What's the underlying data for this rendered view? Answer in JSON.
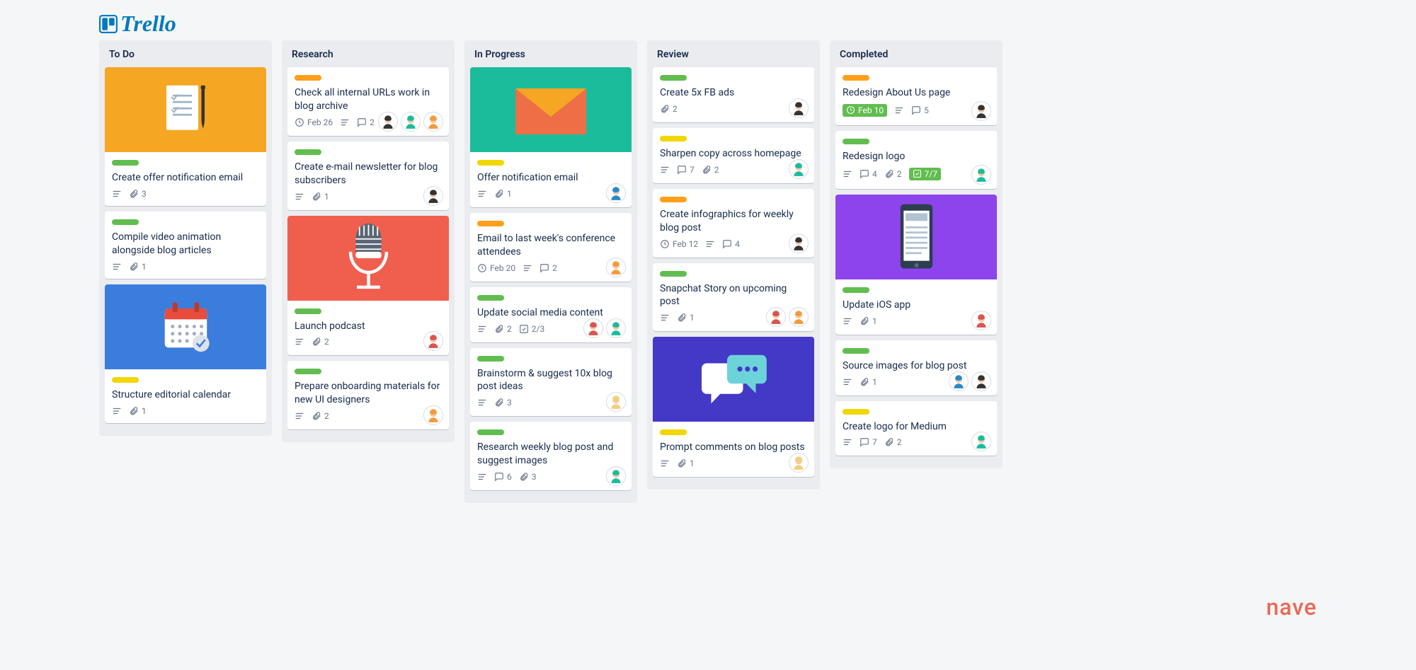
{
  "logo": "Trello",
  "watermark": "nave",
  "avatars": {
    "dark": {
      "hair": "#333",
      "skin": "#f4c9a8"
    },
    "blue": {
      "hair": "#2788c9",
      "skin": "#f4c9a8"
    },
    "orange": {
      "hair": "#f59a3a",
      "skin": "#f4c9a8"
    },
    "teal": {
      "hair": "#1abc9c",
      "skin": "#f4c9a8"
    },
    "redhair": {
      "hair": "#d9534f",
      "skin": "#f4c9a8"
    },
    "blonde": {
      "hair": "#f3cf7a",
      "skin": "#f4c9a8"
    }
  },
  "columns": [
    {
      "title": "To Do",
      "cards": [
        {
          "cover": "orange",
          "coverIcon": "document",
          "labels": [
            "green"
          ],
          "title": "Create offer notification email",
          "description": true,
          "attachments": "3",
          "members": []
        },
        {
          "labels": [
            "green"
          ],
          "title": "Compile video animation alongside blog articles",
          "description": true,
          "attachments": "1",
          "members": []
        },
        {
          "cover": "blue",
          "coverIcon": "calendar",
          "labels": [
            "yellow"
          ],
          "title": "Structure editorial calendar",
          "description": true,
          "attachments": "1",
          "members": []
        }
      ]
    },
    {
      "title": "Research",
      "cards": [
        {
          "labels": [
            "orange"
          ],
          "title": "Check all internal URLs work in blog archive",
          "due": "Feb 26",
          "description": true,
          "comments": "2",
          "members": [
            "dark",
            "teal",
            "orange"
          ]
        },
        {
          "labels": [
            "green"
          ],
          "title": "Create e-mail newsletter for blog subscribers",
          "description": true,
          "attachments": "1",
          "members": [
            "dark"
          ]
        },
        {
          "cover": "red",
          "coverIcon": "mic",
          "labels": [
            "green"
          ],
          "title": "Launch podcast",
          "description": true,
          "attachments": "2",
          "members": [
            "redhair"
          ]
        },
        {
          "labels": [
            "green"
          ],
          "title": "Prepare onboarding materials for new UI designers",
          "description": true,
          "attachments": "2",
          "members": [
            "orange"
          ]
        }
      ]
    },
    {
      "title": "In Progress",
      "cards": [
        {
          "cover": "teal",
          "coverIcon": "envelope",
          "labels": [
            "yellow"
          ],
          "title": "Offer notification email",
          "description": true,
          "attachments": "1",
          "members": [
            "blue"
          ]
        },
        {
          "labels": [
            "orange"
          ],
          "title": "Email to last week's conference attendees",
          "due": "Feb 20",
          "description": true,
          "comments": "2",
          "members": [
            "orange"
          ]
        },
        {
          "labels": [
            "green"
          ],
          "title": "Update social media content",
          "description": true,
          "attachments": "2",
          "checklist": "2/3",
          "members": [
            "redhair",
            "teal"
          ]
        },
        {
          "labels": [
            "green"
          ],
          "title": "Brainstorm & suggest 10x blog post ideas",
          "description": true,
          "attachments": "3",
          "members": [
            "blonde"
          ]
        },
        {
          "labels": [
            "green"
          ],
          "title": "Research weekly blog post and suggest images",
          "description": true,
          "attachments": "3",
          "comments": "6",
          "members": [
            "teal"
          ]
        }
      ]
    },
    {
      "title": "Review",
      "cards": [
        {
          "labels": [
            "green"
          ],
          "title": "Create 5x FB ads",
          "attachments": "2",
          "members": [
            "dark"
          ]
        },
        {
          "labels": [
            "yellow"
          ],
          "title": "Sharpen copy across homepage",
          "description": true,
          "comments": "7",
          "attachments": "2",
          "members": [
            "teal"
          ]
        },
        {
          "labels": [
            "orange"
          ],
          "title": "Create infographics for weekly blog post",
          "due": "Feb 12",
          "description": true,
          "comments": "4",
          "members": [
            "dark"
          ]
        },
        {
          "labels": [
            "green"
          ],
          "title": "Snapchat Story on upcoming post",
          "description": true,
          "attachments": "1",
          "members": [
            "redhair",
            "orange"
          ]
        },
        {
          "cover": "indigo",
          "coverIcon": "chat",
          "labels": [
            "yellow"
          ],
          "title": "Prompt comments on blog posts",
          "description": true,
          "attachments": "1",
          "members": [
            "blonde"
          ]
        }
      ]
    },
    {
      "title": "Completed",
      "cards": [
        {
          "labels": [
            "orange"
          ],
          "title": "Redesign About Us page",
          "duePill": "Feb 10",
          "description": true,
          "comments": "5",
          "members": [
            "dark"
          ]
        },
        {
          "labels": [
            "green"
          ],
          "title": "Redesign logo",
          "description": true,
          "comments": "4",
          "attachments": "2",
          "checklistPill": "7/7",
          "members": [
            "teal"
          ]
        },
        {
          "cover": "purple",
          "coverIcon": "phone",
          "labels": [
            "green"
          ],
          "title": "Update iOS app",
          "description": true,
          "attachments": "1",
          "members": [
            "redhair"
          ]
        },
        {
          "labels": [
            "green"
          ],
          "title": "Source images for blog post",
          "description": true,
          "attachments": "1",
          "members": [
            "blue",
            "dark"
          ]
        },
        {
          "labels": [
            "yellow"
          ],
          "title": "Create logo for Medium",
          "description": true,
          "comments": "7",
          "attachments": "2",
          "members": [
            "teal"
          ]
        }
      ]
    }
  ]
}
